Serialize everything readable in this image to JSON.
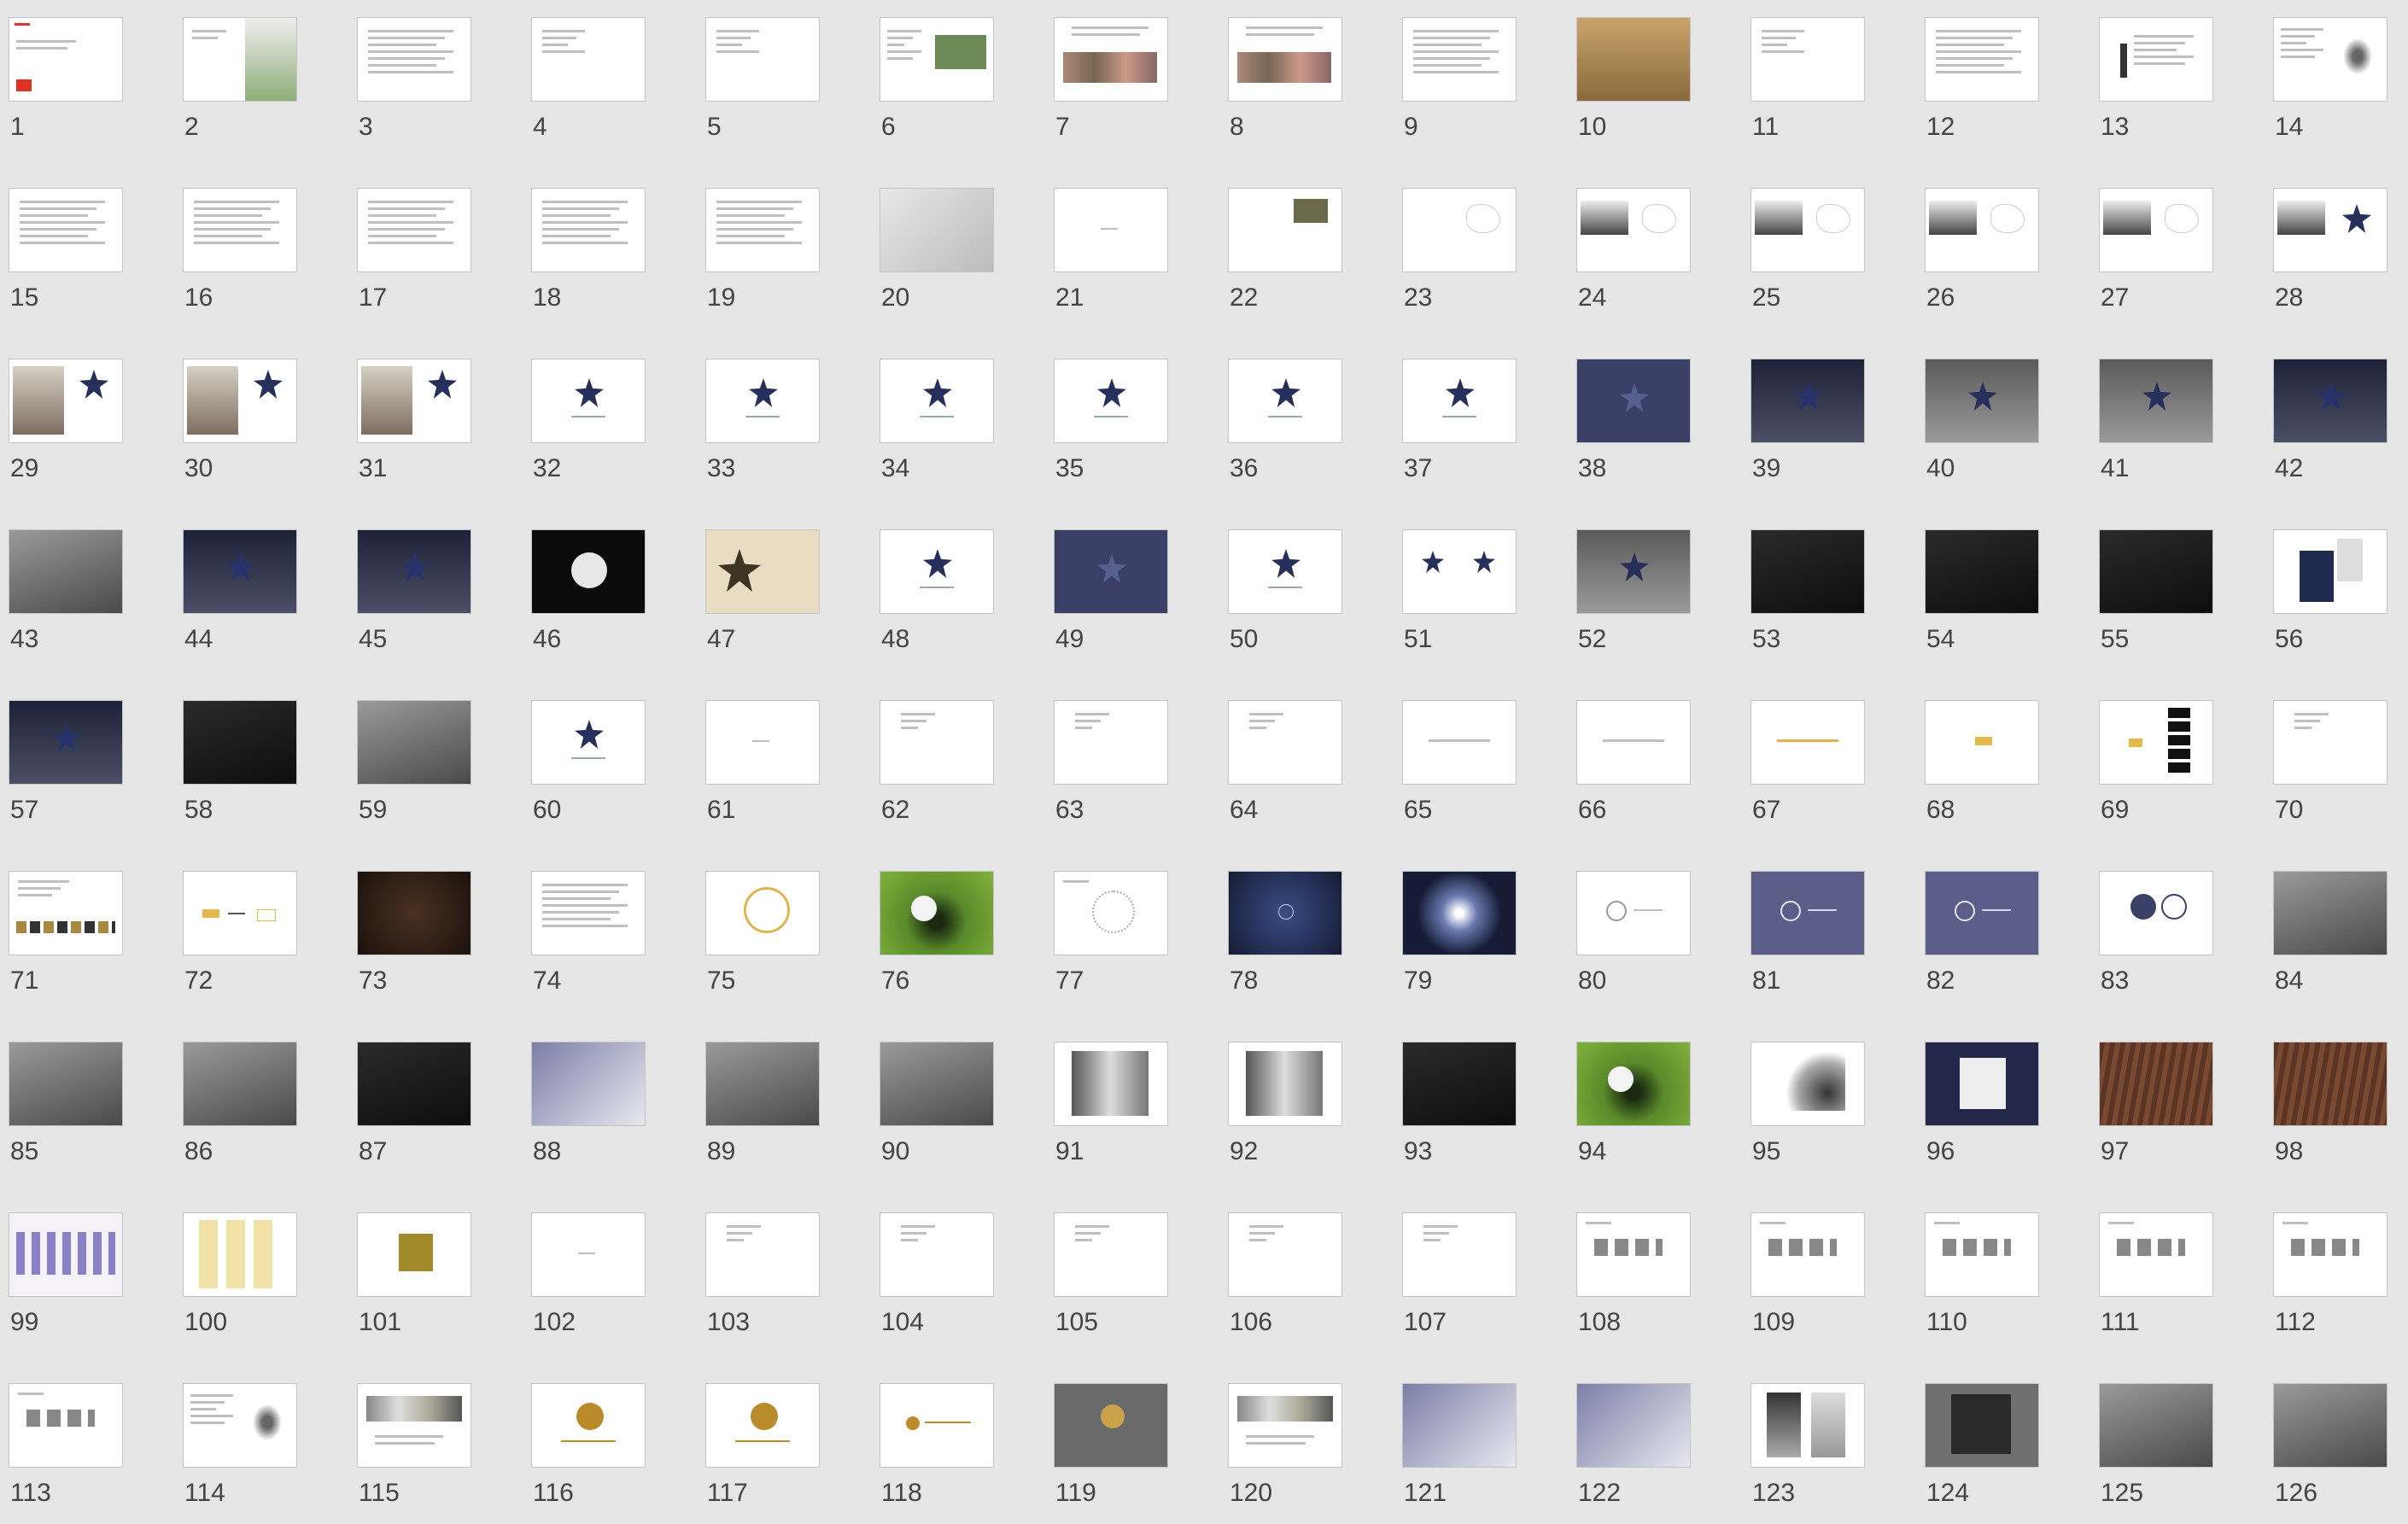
{
  "slides": [
    {
      "n": "1",
      "style": "white-logo"
    },
    {
      "n": "2",
      "style": "white-photo"
    },
    {
      "n": "3",
      "style": "text"
    },
    {
      "n": "4",
      "style": "text-short"
    },
    {
      "n": "5",
      "style": "text-short"
    },
    {
      "n": "6",
      "style": "text-photo"
    },
    {
      "n": "7",
      "style": "text-photos"
    },
    {
      "n": "8",
      "style": "text-photos"
    },
    {
      "n": "9",
      "style": "text"
    },
    {
      "n": "10",
      "style": "sepia"
    },
    {
      "n": "11",
      "style": "text-short"
    },
    {
      "n": "12",
      "style": "text"
    },
    {
      "n": "13",
      "style": "diagram"
    },
    {
      "n": "14",
      "style": "text-calligraphy"
    },
    {
      "n": "15",
      "style": "text"
    },
    {
      "n": "16",
      "style": "text"
    },
    {
      "n": "17",
      "style": "text"
    },
    {
      "n": "18",
      "style": "text"
    },
    {
      "n": "19",
      "style": "text"
    },
    {
      "n": "20",
      "style": "grey-sketch"
    },
    {
      "n": "21",
      "style": "blank-dot"
    },
    {
      "n": "22",
      "style": "small-photo"
    },
    {
      "n": "23",
      "style": "map-outline"
    },
    {
      "n": "24",
      "style": "photo-map"
    },
    {
      "n": "25",
      "style": "photo-map"
    },
    {
      "n": "26",
      "style": "photo-map"
    },
    {
      "n": "27",
      "style": "photo-map"
    },
    {
      "n": "28",
      "style": "photo-star"
    },
    {
      "n": "29",
      "style": "buddha-star"
    },
    {
      "n": "30",
      "style": "buddha-star"
    },
    {
      "n": "31",
      "style": "buddha-star"
    },
    {
      "n": "32",
      "style": "star-logo"
    },
    {
      "n": "33",
      "style": "star-logo"
    },
    {
      "n": "34",
      "style": "star-logo"
    },
    {
      "n": "35",
      "style": "star-logo"
    },
    {
      "n": "36",
      "style": "star-logo"
    },
    {
      "n": "37",
      "style": "star-logo"
    },
    {
      "n": "38",
      "style": "navy-star"
    },
    {
      "n": "39",
      "style": "dark-star"
    },
    {
      "n": "40",
      "style": "grey-star"
    },
    {
      "n": "41",
      "style": "grey-star"
    },
    {
      "n": "42",
      "style": "dark-star"
    },
    {
      "n": "43",
      "style": "grey-photo"
    },
    {
      "n": "44",
      "style": "dark-star"
    },
    {
      "n": "45",
      "style": "dark-star"
    },
    {
      "n": "46",
      "style": "black-moon"
    },
    {
      "n": "47",
      "style": "beige-star"
    },
    {
      "n": "48",
      "style": "star-logo"
    },
    {
      "n": "49",
      "style": "navy-star"
    },
    {
      "n": "50",
      "style": "star-logo"
    },
    {
      "n": "51",
      "style": "two-stars"
    },
    {
      "n": "52",
      "style": "grey-star"
    },
    {
      "n": "53",
      "style": "dark-photo"
    },
    {
      "n": "54",
      "style": "dark-photo"
    },
    {
      "n": "55",
      "style": "dark-photo"
    },
    {
      "n": "56",
      "style": "bag"
    },
    {
      "n": "57",
      "style": "dark-star"
    },
    {
      "n": "58",
      "style": "dark-photo"
    },
    {
      "n": "59",
      "style": "grey-photo"
    },
    {
      "n": "60",
      "style": "star-logo"
    },
    {
      "n": "61",
      "style": "blank-dot"
    },
    {
      "n": "62",
      "style": "blank-text"
    },
    {
      "n": "63",
      "style": "blank-text"
    },
    {
      "n": "64",
      "style": "blank-text"
    },
    {
      "n": "65",
      "style": "center-text"
    },
    {
      "n": "66",
      "style": "center-text"
    },
    {
      "n": "67",
      "style": "gold-text"
    },
    {
      "n": "68",
      "style": "gold-mark"
    },
    {
      "n": "69",
      "style": "gold-black"
    },
    {
      "n": "70",
      "style": "blank-text"
    },
    {
      "n": "71",
      "style": "swatches"
    },
    {
      "n": "72",
      "style": "gold-arrow"
    },
    {
      "n": "73",
      "style": "beads"
    },
    {
      "n": "74",
      "style": "text"
    },
    {
      "n": "75",
      "style": "gold-ring"
    },
    {
      "n": "76",
      "style": "golf-green"
    },
    {
      "n": "77",
      "style": "dot-ring"
    },
    {
      "n": "78",
      "style": "navy-seal"
    },
    {
      "n": "79",
      "style": "navy-glow"
    },
    {
      "n": "80",
      "style": "seal-white"
    },
    {
      "n": "81",
      "style": "purple-seal"
    },
    {
      "n": "82",
      "style": "purple-seal"
    },
    {
      "n": "83",
      "style": "circles"
    },
    {
      "n": "84",
      "style": "grey-photo"
    },
    {
      "n": "85",
      "style": "grey-photo"
    },
    {
      "n": "86",
      "style": "grey-photo"
    },
    {
      "n": "87",
      "style": "dark-photo"
    },
    {
      "n": "88",
      "style": "stationery"
    },
    {
      "n": "89",
      "style": "grey-photo"
    },
    {
      "n": "90",
      "style": "grey-photo"
    },
    {
      "n": "91",
      "style": "book"
    },
    {
      "n": "92",
      "style": "book"
    },
    {
      "n": "93",
      "style": "dark-photo"
    },
    {
      "n": "94",
      "style": "golf-green"
    },
    {
      "n": "95",
      "style": "club"
    },
    {
      "n": "96",
      "style": "navy-card"
    },
    {
      "n": "97",
      "style": "wood"
    },
    {
      "n": "98",
      "style": "wood"
    },
    {
      "n": "99",
      "style": "icons"
    },
    {
      "n": "100",
      "style": "bottles"
    },
    {
      "n": "101",
      "style": "gold-char"
    },
    {
      "n": "102",
      "style": "blank-dot"
    },
    {
      "n": "103",
      "style": "blank-text"
    },
    {
      "n": "104",
      "style": "blank-text"
    },
    {
      "n": "105",
      "style": "blank-text"
    },
    {
      "n": "106",
      "style": "blank-text"
    },
    {
      "n": "107",
      "style": "blank-text"
    },
    {
      "n": "108",
      "style": "small-thumbs"
    },
    {
      "n": "109",
      "style": "small-thumbs"
    },
    {
      "n": "110",
      "style": "small-thumbs"
    },
    {
      "n": "111",
      "style": "small-thumbs"
    },
    {
      "n": "112",
      "style": "small-thumbs"
    },
    {
      "n": "113",
      "style": "small-thumbs"
    },
    {
      "n": "114",
      "style": "text-calligraphy"
    },
    {
      "n": "115",
      "style": "photo-strip"
    },
    {
      "n": "116",
      "style": "gold-seal"
    },
    {
      "n": "117",
      "style": "gold-seal"
    },
    {
      "n": "118",
      "style": "gold-seal-small"
    },
    {
      "n": "119",
      "style": "grey-seal"
    },
    {
      "n": "120",
      "style": "photo-strip"
    },
    {
      "n": "121",
      "style": "stationery"
    },
    {
      "n": "122",
      "style": "stationery"
    },
    {
      "n": "123",
      "style": "cards"
    },
    {
      "n": "124",
      "style": "grey-book"
    },
    {
      "n": "125",
      "style": "grey-photo"
    },
    {
      "n": "126",
      "style": "grey-photo"
    }
  ]
}
